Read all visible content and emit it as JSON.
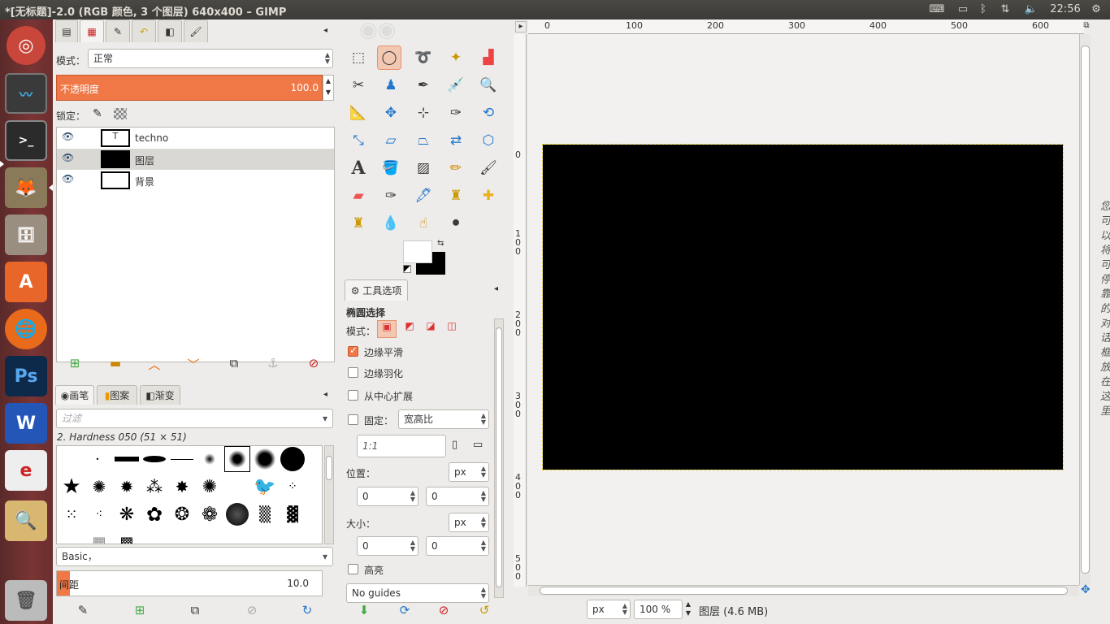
{
  "window": {
    "title": "*[无标题]-2.0 (RGB 颜色, 3 个图层) 640x400 – GIMP"
  },
  "tray": {
    "time": "22:56"
  },
  "layers": {
    "mode_label": "模式：",
    "mode_value": "正常",
    "opacity_label": "不透明度",
    "opacity_value": "100.0",
    "lock_label": "锁定：",
    "items": [
      {
        "name": "techno"
      },
      {
        "name": "图层"
      },
      {
        "name": "背景"
      }
    ]
  },
  "brushes": {
    "tabs": [
      "画笔",
      "图案",
      "渐变"
    ],
    "filter_placeholder": "过滤",
    "current": "2. Hardness 050 (51 × 51)",
    "preset": "Basic，",
    "spacing_label": "间距",
    "spacing_value": "10.0"
  },
  "tool_options": {
    "tab_label": "工具选项",
    "title": "椭圆选择",
    "mode_label": "模式：",
    "antialias_label": "边缘平滑",
    "feather_label": "边缘羽化",
    "expand_center_label": "从中心扩展",
    "fixed_label": "固定：",
    "fixed_value": "宽高比",
    "ratio_value": "1:1",
    "position_label": "位置：",
    "position_unit": "px",
    "pos_x": "0",
    "pos_y": "0",
    "size_label": "大小：",
    "size_unit": "px",
    "size_w": "0",
    "size_h": "0",
    "highlight_label": "高亮",
    "guides_value": "No guides"
  },
  "canvas": {
    "ruler_ticks": [
      "0",
      "100",
      "200",
      "300",
      "400",
      "500",
      "600"
    ],
    "v_ticks": [
      "0",
      "100",
      "200",
      "300",
      "400",
      "500"
    ],
    "unit": "px",
    "zoom": "100 %",
    "status": "图层 (4.6 MB)",
    "side_text": "您可以将可停靠的对话框放在这里"
  },
  "colors": {
    "accent": "#f07746",
    "launcher": "#6f3030"
  }
}
